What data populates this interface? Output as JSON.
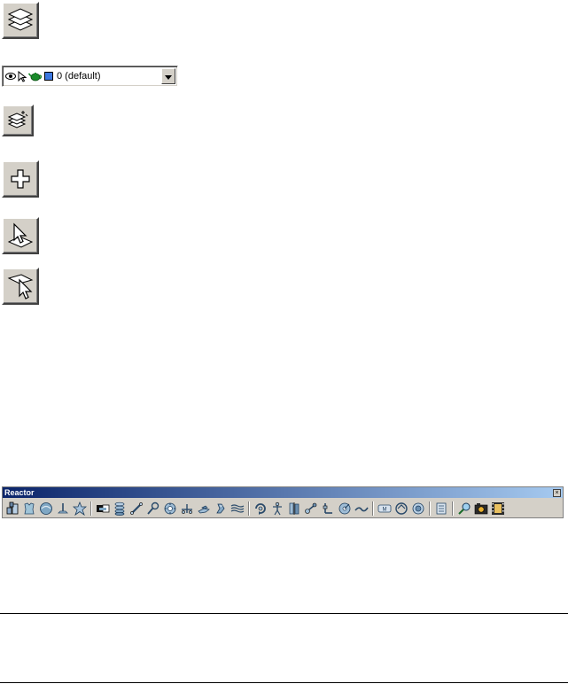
{
  "layer_dropdown": {
    "selected_value": "0 (default)"
  },
  "reactor_toolbar": {
    "title": "Reactor",
    "close_glyph": "×"
  },
  "icons": {
    "layer_manager": "layers-stack-icon",
    "layer_properties": "layer-properties-icon",
    "create_new_layer": "plus-icon",
    "select_objects_in_layer": "select-objects-in-layer-icon",
    "set_current_layer_to_selection": "select-layer-arrow-icon"
  },
  "colors": {
    "titlebar_start": "#0a246a",
    "titlebar_end": "#a6caf0",
    "button_face": "#d4d0c8"
  }
}
